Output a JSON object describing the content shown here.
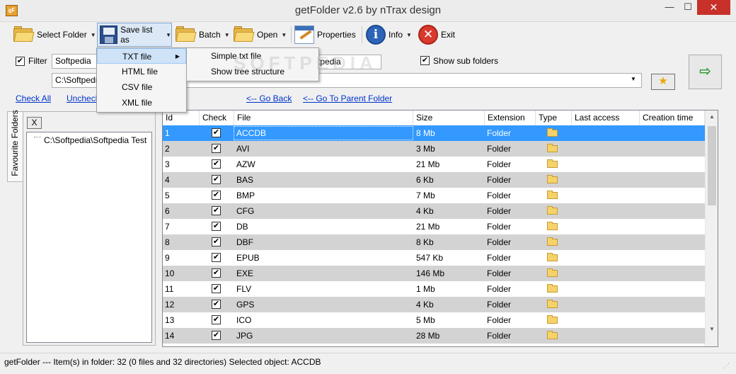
{
  "window": {
    "title": "getFolder v2.6 by nTrax design",
    "app_icon_text": "gF",
    "minimize_glyph": "—",
    "maximize_glyph": "☐",
    "close_glyph": "✕"
  },
  "toolbar": {
    "select_folder": "Select Folder",
    "save_list_as": "Save list as",
    "batch": "Batch",
    "open": "Open",
    "properties": "Properties",
    "info": "Info",
    "exit": "Exit",
    "info_glyph": "i",
    "exit_glyph": "✕",
    "dropdown_glyph": "▼"
  },
  "filter": {
    "checkbox_label": "Filter",
    "checked": true,
    "value": "Softpedia",
    "second_value": "oftpedia",
    "show_sub_folders_label": "Show sub folders",
    "show_sub_folders_checked": true,
    "path": "C:\\Softpedia",
    "combo_arrow": "▼",
    "go_glyph": "⇨",
    "star_glyph": "★"
  },
  "links": {
    "check_all": "Check All",
    "uncheck_all": "Uncheck",
    "go_back": "<-- Go Back",
    "go_parent": "<-- Go To Parent Folder"
  },
  "save_menu": {
    "items": [
      "TXT file",
      "HTML file",
      "CSV file",
      "XML file"
    ],
    "highlighted": "TXT file",
    "submenu_arrow": "▶"
  },
  "txt_submenu": {
    "items": [
      "Simple txt file",
      "Show tree structure"
    ]
  },
  "favourites": {
    "tab_label": "Favourite Folders",
    "remove_button": "X",
    "tree_item": "C:\\Softpedia\\Softpedia Test"
  },
  "grid": {
    "columns": [
      "Id",
      "Check",
      "File",
      "Size",
      "Extension",
      "Type",
      "Last access",
      "Creation time"
    ],
    "check_glyph": "✔",
    "selected_row": 1,
    "rows": [
      {
        "id": "1",
        "file": "ACCDB",
        "size": "8 Mb",
        "ext": "Folder"
      },
      {
        "id": "2",
        "file": "AVI",
        "size": "3 Mb",
        "ext": "Folder"
      },
      {
        "id": "3",
        "file": "AZW",
        "size": "21 Mb",
        "ext": "Folder"
      },
      {
        "id": "4",
        "file": "BAS",
        "size": "6 Kb",
        "ext": "Folder"
      },
      {
        "id": "5",
        "file": "BMP",
        "size": "7 Mb",
        "ext": "Folder"
      },
      {
        "id": "6",
        "file": "CFG",
        "size": "4 Kb",
        "ext": "Folder"
      },
      {
        "id": "7",
        "file": "DB",
        "size": "21 Mb",
        "ext": "Folder"
      },
      {
        "id": "8",
        "file": "DBF",
        "size": "8 Kb",
        "ext": "Folder"
      },
      {
        "id": "9",
        "file": "EPUB",
        "size": "547 Kb",
        "ext": "Folder"
      },
      {
        "id": "10",
        "file": "EXE",
        "size": "146 Mb",
        "ext": "Folder"
      },
      {
        "id": "11",
        "file": "FLV",
        "size": "1 Mb",
        "ext": "Folder"
      },
      {
        "id": "12",
        "file": "GPS",
        "size": "4 Kb",
        "ext": "Folder"
      },
      {
        "id": "13",
        "file": "ICO",
        "size": "5 Mb",
        "ext": "Folder"
      },
      {
        "id": "14",
        "file": "JPG",
        "size": "28 Mb",
        "ext": "Folder"
      }
    ],
    "scroll_up": "▲",
    "scroll_down": "▼"
  },
  "statusbar": {
    "text": "getFolder --- Item(s) in folder: 32 (0 files and 32 directories)  Selected object: ACCDB",
    "grip": "⋰"
  },
  "watermark": "SOFTPEDIA"
}
